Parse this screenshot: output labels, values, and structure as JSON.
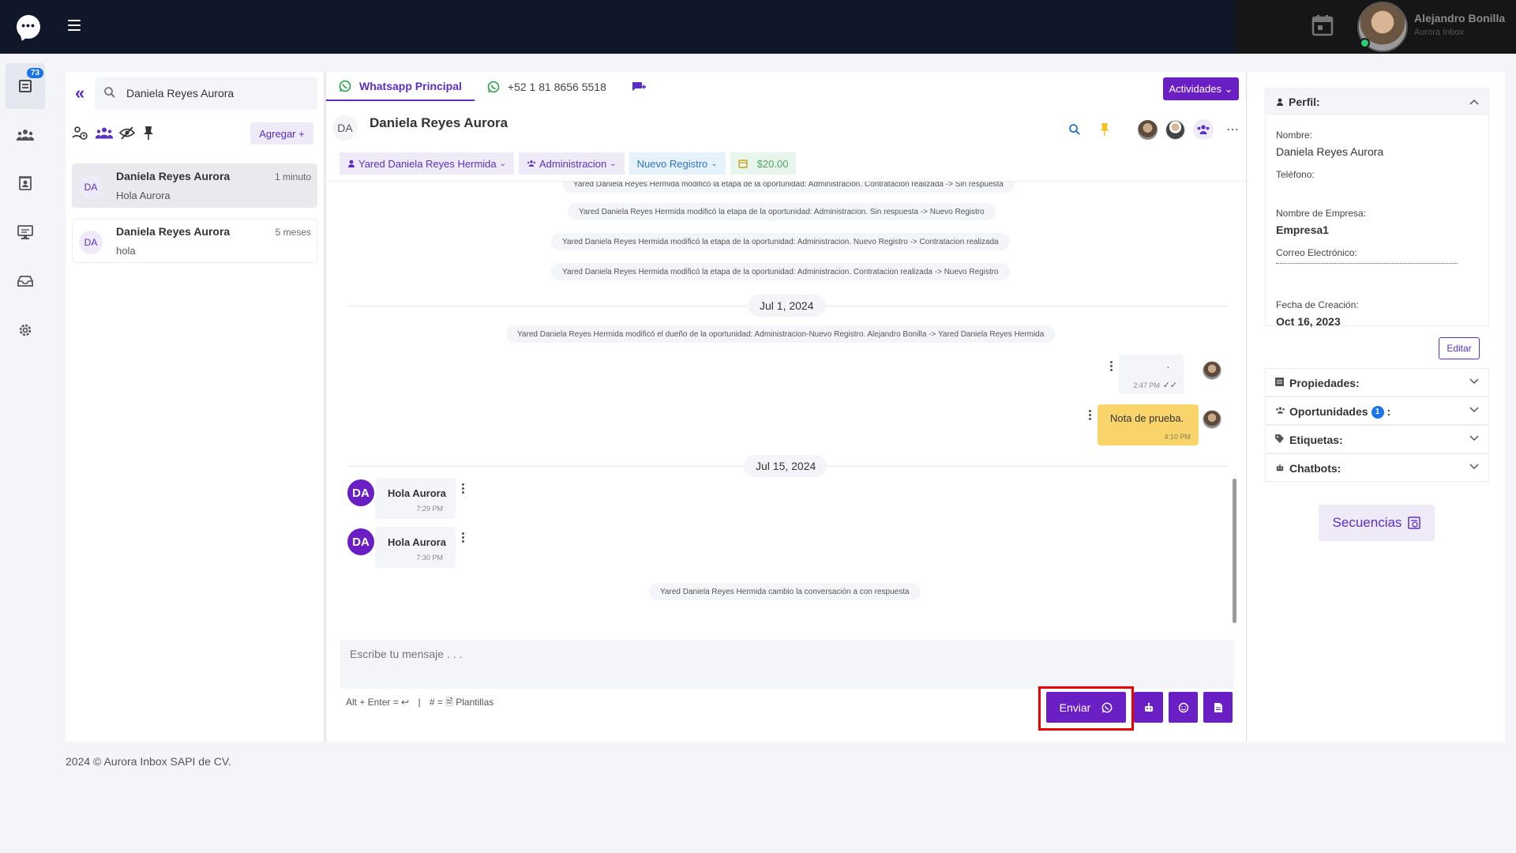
{
  "header": {
    "user_name": "Alejandro Bonilla",
    "user_sub": "Aurora Inbox",
    "icons": [
      "chat-bubble-logo-icon",
      "hamburger-icon",
      "calendar-icon"
    ]
  },
  "rail": {
    "badge": "73",
    "items": [
      "conversations-icon",
      "contacts-icon",
      "agenda-icon",
      "monitor-icon",
      "inbox-icon",
      "settings-icon"
    ]
  },
  "sidebar": {
    "search_value": "Daniela Reyes Aurora",
    "add_label": "Agregar +",
    "conversations": [
      {
        "initials": "DA",
        "name": "Daniela Reyes Aurora",
        "time": "1 minuto",
        "last": "Hola Aurora"
      },
      {
        "initials": "DA",
        "name": "Daniela Reyes Aurora",
        "time": "5 meses",
        "last": "hola"
      }
    ]
  },
  "chat": {
    "tabs": [
      "Whatsapp Principal",
      "+52 1 81 8656 5518"
    ],
    "activities_label": "Actividades",
    "contact_initials": "DA",
    "contact_name": "Daniela Reyes Aurora",
    "tags": {
      "owner": "Yared Daniela Reyes Hermida",
      "team": "Administracion",
      "stage": "Nuevo Registro",
      "amount": "$20.00"
    },
    "system_messages": [
      "Yared Daniela Reyes Hermida modificó la etapa de la oportunidad: Administracion. Contratacion realizada -> Sin respuesta",
      "Yared Daniela Reyes Hermida modificó la etapa de la oportunidad: Administracion. Sin respuesta -> Nuevo Registro",
      "Yared Daniela Reyes Hermida modificó la etapa de la oportunidad: Administracion. Nuevo Registro -> Contratacion realizada",
      "Yared Daniela Reyes Hermida modificó la etapa de la oportunidad: Administracion. Contratacion realizada -> Nuevo Registro"
    ],
    "date1": "Jul 1, 2024",
    "owner_change": "Yared Daniela Reyes Hermida modificó el dueño de la oportunidad: Administracion-Nuevo Registro. Alejandro Bonilla -> Yared Daniela Reyes Hermida",
    "out_messages": [
      {
        "text": ".",
        "time": "2:47 PM"
      },
      {
        "text": "Nota de prueba.",
        "time": "4:10 PM"
      }
    ],
    "date2": "Jul 15, 2024",
    "in_messages": [
      {
        "initials": "DA",
        "text": "Hola Aurora",
        "time": "7:29 PM"
      },
      {
        "initials": "DA",
        "text": "Hola Aurora",
        "time": "7:30 PM"
      }
    ],
    "status_change": "Yared Daniela Reyes Hermida cambio la conversación a con respuesta",
    "composer_placeholder": "Escribe tu mensaje . . .",
    "hint_left": "Alt + Enter = ↩",
    "hint_right": "# = 🗎 Plantillas",
    "send_label": "Enviar",
    "colors": {
      "primary": "#6a1fc5",
      "note": "#f9d46b",
      "highlight": "#e00000"
    }
  },
  "profile": {
    "section_title": "Perfil:",
    "name_label": "Nombre:",
    "name_value": "Daniela Reyes Aurora",
    "phone_label": "Teléfono:",
    "phone_value": "",
    "company_label": "Nombre de Empresa:",
    "company_value": "Empresa1",
    "email_label": "Correo Electrónico:",
    "created_label": "Fecha de Creación:",
    "created_value": "Oct 16, 2023",
    "edit_label": "Editar",
    "sections": [
      "Propiedades:",
      "Oportunidades",
      "Etiquetas:",
      "Chatbots:"
    ],
    "opportunities_count": "1",
    "sequences_label": "Secuencias"
  },
  "footer": {
    "text": "2024 © Aurora Inbox SAPI de CV."
  }
}
